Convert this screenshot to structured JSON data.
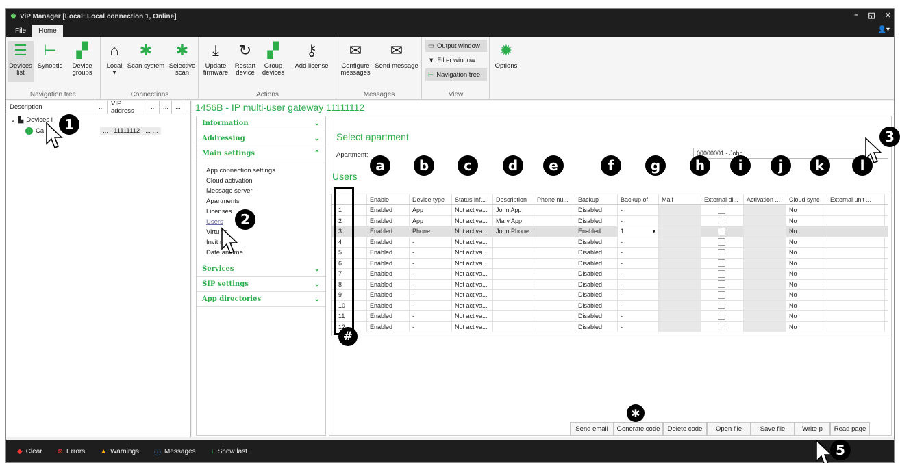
{
  "window": {
    "title": "ViP Manager [Local: Local connection 1, Online]",
    "controls": [
      "–",
      "◱",
      "✕"
    ]
  },
  "menu": {
    "tabs": [
      "File",
      "Home"
    ],
    "user_icon": "user-icon"
  },
  "ribbon": {
    "nav": {
      "label": "Navigation tree",
      "buttons": [
        "Devices list",
        "Synoptic",
        "Device groups"
      ]
    },
    "conn": {
      "label": "Connections",
      "buttons": [
        "Local",
        "Scan system",
        "Selective scan"
      ]
    },
    "actions": {
      "label": "Actions",
      "buttons": [
        "Update firmware",
        "Restart device",
        "Group devices",
        "Add license"
      ]
    },
    "messages": {
      "label": "Messages",
      "buttons": [
        "Configure messages",
        "Send message"
      ]
    },
    "view": {
      "label": "View",
      "buttons": [
        "Output window",
        "Filter window",
        "Navigation tree"
      ]
    },
    "options": "Options"
  },
  "left": {
    "headers": [
      "Description",
      "...",
      "VIP address",
      "...",
      "...",
      "..."
    ],
    "tree": {
      "root": "Devices l",
      "child": "Ca",
      "child_dots": "...",
      "child_addr": "11111112",
      "child_extra": "...   ..."
    }
  },
  "device_title": "1456B - IP multi-user gateway 11111112",
  "sidemenu": {
    "sections": [
      "Information",
      "Addressing",
      "Main settings",
      "Services",
      "SIP settings",
      "App directories"
    ],
    "items": [
      "App connection settings",
      "Cloud activation",
      "Message server",
      "Apartments",
      "Licenses",
      "Users",
      "Virtu   ys",
      "Invit   mail",
      "Date an   time"
    ]
  },
  "content": {
    "select_title": "Select apartment",
    "apt_label": "Apartment:",
    "apt_value": "00000001 - John",
    "users_title": "Users",
    "columns": [
      "",
      "Enable",
      "Device type",
      "Status inf...",
      "Description",
      "Phone nu...",
      "Backup",
      "Backup of",
      "Mail",
      "External di...",
      "Activation ...",
      "Cloud sync",
      "External unit ..."
    ],
    "rows": [
      [
        "1",
        "Enabled",
        "App",
        "Not activa...",
        "John App",
        "",
        "Disabled",
        "-",
        "",
        "",
        "",
        "No",
        ""
      ],
      [
        "2",
        "Enabled",
        "App",
        "Not activa...",
        "Mary App",
        "",
        "Disabled",
        "-",
        "",
        "",
        "",
        "No",
        ""
      ],
      [
        "3",
        "Enabled",
        "Phone",
        "Not activa...",
        "John Phone",
        "",
        "Enabled",
        "1",
        "",
        "",
        "",
        "No",
        ""
      ],
      [
        "4",
        "Enabled",
        "-",
        "Not activa...",
        "",
        "",
        "Disabled",
        "-",
        "",
        "",
        "",
        "No",
        ""
      ],
      [
        "5",
        "Enabled",
        "-",
        "Not activa...",
        "",
        "",
        "Disabled",
        "-",
        "",
        "",
        "",
        "No",
        ""
      ],
      [
        "6",
        "Enabled",
        "-",
        "Not activa...",
        "",
        "",
        "Disabled",
        "-",
        "",
        "",
        "",
        "No",
        ""
      ],
      [
        "7",
        "Enabled",
        "-",
        "Not activa...",
        "",
        "",
        "Disabled",
        "-",
        "",
        "",
        "",
        "No",
        ""
      ],
      [
        "8",
        "Enabled",
        "-",
        "Not activa...",
        "",
        "",
        "Disabled",
        "-",
        "",
        "",
        "",
        "No",
        ""
      ],
      [
        "9",
        "Enabled",
        "-",
        "Not activa...",
        "",
        "",
        "Disabled",
        "-",
        "",
        "",
        "",
        "No",
        ""
      ],
      [
        "10",
        "Enabled",
        "-",
        "Not activa...",
        "",
        "",
        "Disabled",
        "-",
        "",
        "",
        "",
        "No",
        ""
      ],
      [
        "11",
        "Enabled",
        "-",
        "Not activa...",
        "",
        "",
        "Disabled",
        "-",
        "",
        "",
        "",
        "No",
        ""
      ],
      [
        "12",
        "Enabled",
        "-",
        "Not activa...",
        "",
        "",
        "Disabled",
        "-",
        "",
        "",
        "",
        "No",
        ""
      ]
    ],
    "buttons": [
      "Send email",
      "Generate code",
      "Delete code",
      "Open file",
      "Save file",
      "Write p",
      "Read page"
    ]
  },
  "status": {
    "items": [
      "Clear",
      "Errors",
      "Warnings",
      "Messages",
      "Show last"
    ]
  },
  "annotations": [
    "1",
    "2",
    "3",
    "5",
    "a",
    "b",
    "c",
    "d",
    "e",
    "f",
    "g",
    "h",
    "i",
    "j",
    "k",
    "l",
    "#",
    "✱"
  ],
  "colors": {
    "accent": "#2bae4a",
    "titlebar": "#1e1e1e"
  }
}
